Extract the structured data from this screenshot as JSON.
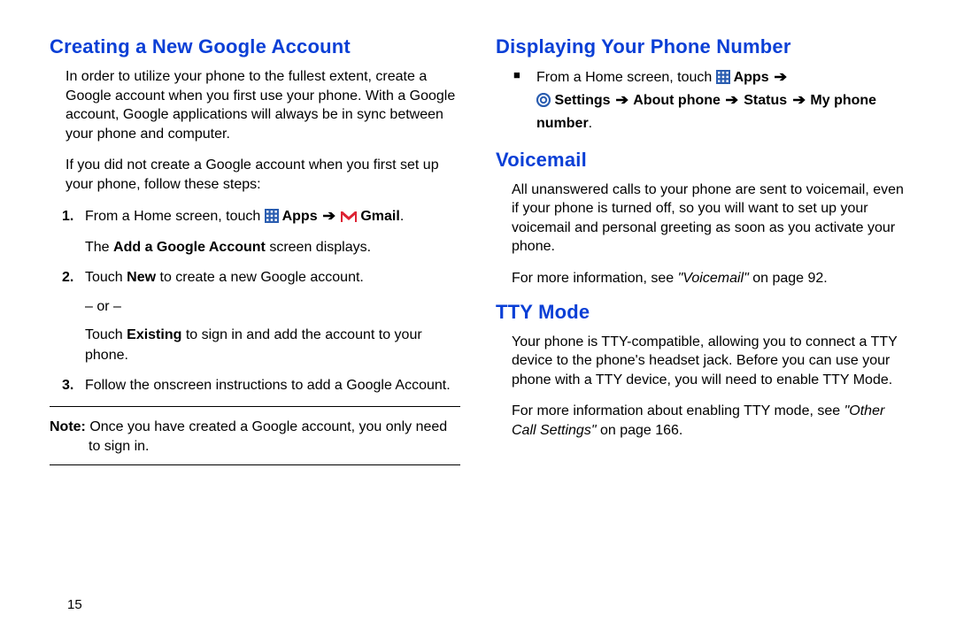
{
  "pageNumber": "15",
  "left": {
    "heading": "Creating a New Google Account",
    "p1": "In order to utilize your phone to the fullest extent, create a Google account when you first use your phone. With a Google account, Google applications will always be in sync between your phone and computer.",
    "p2": "If you did not create a Google account when you first set up your phone, follow these steps:",
    "step1_a": "From a Home screen, touch ",
    "step1_apps": " Apps ",
    "step1_gmail": " Gmail",
    "step1_period": ".",
    "step1_sub_a": "The ",
    "step1_sub_b": "Add a Google Account",
    "step1_sub_c": " screen displays.",
    "step2_a": "Touch ",
    "step2_b": "New",
    "step2_c": " to create a new Google account.",
    "step2_or": "– or –",
    "step2_sub_a": "Touch ",
    "step2_sub_b": "Existing",
    "step2_sub_c": " to sign in and add the account to your phone.",
    "step3": "Follow the onscreen instructions to add a Google Account.",
    "note_label": "Note: ",
    "note_text": "Once you have created a Google account, you only need to sign in."
  },
  "right": {
    "h_display": "Displaying Your Phone Number",
    "disp_a": "From a Home screen, touch ",
    "disp_apps": " Apps ",
    "disp_settings": " Settings ",
    "disp_about": " About phone ",
    "disp_status": " Status ",
    "disp_mynum": " My phone number",
    "disp_period": ".",
    "h_vm": "Voicemail",
    "vm_p1": "All unanswered calls to your phone are sent to voicemail, even if your phone is turned off, so you will want to set up your voicemail and personal greeting as soon as you activate your phone.",
    "vm_p2_a": "For more information, see ",
    "vm_p2_b": "\"Voicemail\"",
    "vm_p2_c": " on page 92.",
    "h_tty": "TTY Mode",
    "tty_p1": "Your phone is TTY-compatible, allowing you to connect a TTY device to the phone's headset jack. Before you can use your phone with a TTY device, you will need to enable TTY Mode.",
    "tty_p2_a": "For more information about enabling TTY mode, see ",
    "tty_p2_b": "\"Other Call Settings\"",
    "tty_p2_c": " on page 166."
  },
  "labels": {
    "num1": "1.",
    "num2": "2.",
    "num3": "3.",
    "arrow": "➔"
  }
}
